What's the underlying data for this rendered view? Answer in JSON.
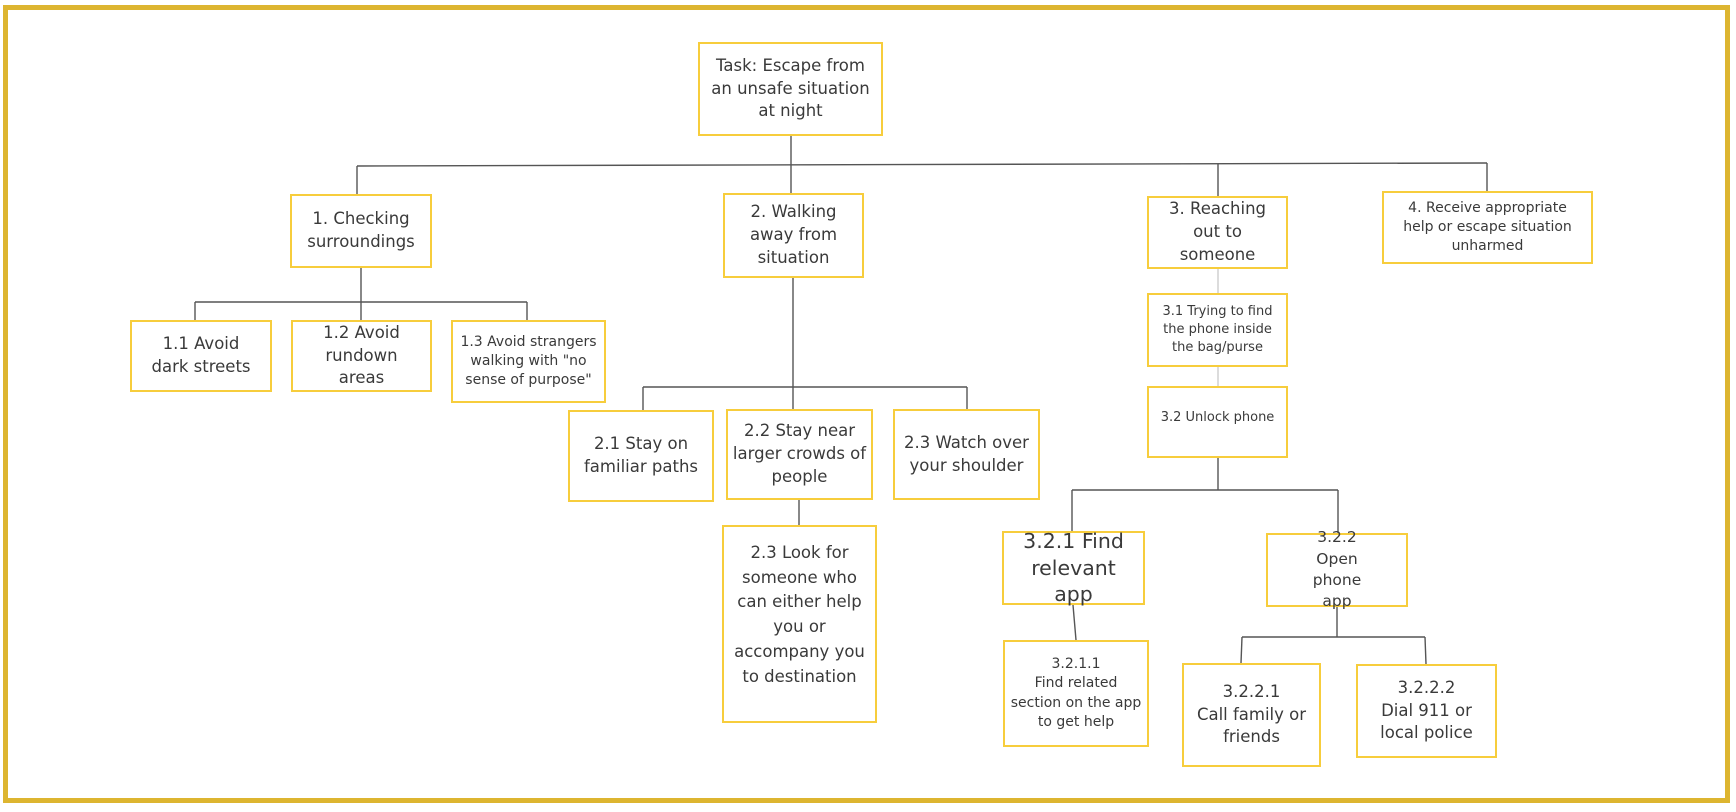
{
  "diagram": {
    "type": "hierarchical-task-analysis",
    "colors": {
      "frame_border": "#DDB530",
      "node_border": "#F7CD3C",
      "connector": "#555555",
      "connector_light": "#cccccc",
      "text": "#3a3a3a"
    },
    "nodes": {
      "root": "Task: Escape from an unsafe situation at night",
      "n1": "1. Checking surroundings",
      "n1_1": "1.1 Avoid dark streets",
      "n1_2": "1.2 Avoid rundown areas",
      "n1_3": "1.3 Avoid strangers walking with \"no sense of purpose\"",
      "n2": "2. Walking away from situation",
      "n2_1": "2.1 Stay on familiar paths",
      "n2_2": "2.2 Stay near larger crowds of people",
      "n2_3a": "2.3 Watch over your shoulder",
      "n2_3b": "2.3 Look for someone who can either help you or accompany you to destination",
      "n3": "3. Reaching out to someone",
      "n3_1": "3.1 Trying to find the phone inside the bag/purse",
      "n3_2": "3.2 Unlock phone",
      "n3_2_1": "3.2.1 Find relevant app",
      "n3_2_1_1_num": "3.2.1.1",
      "n3_2_1_1": "Find related section on the app to get help",
      "n3_2_2": "3.2.2 Open phone app",
      "n3_2_2_1_num": "3.2.2.1",
      "n3_2_2_1": "Call family or friends",
      "n3_2_2_2_num": "3.2.2.2",
      "n3_2_2_2": "Dial 911 or local police",
      "n4": "4. Receive appropriate help or escape situation unharmed"
    },
    "edges": [
      [
        "root",
        "n1"
      ],
      [
        "root",
        "n2"
      ],
      [
        "root",
        "n3"
      ],
      [
        "root",
        "n4"
      ],
      [
        "n1",
        "n1_1"
      ],
      [
        "n1",
        "n1_2"
      ],
      [
        "n1",
        "n1_3"
      ],
      [
        "n2",
        "n2_1"
      ],
      [
        "n2",
        "n2_2"
      ],
      [
        "n2",
        "n2_3a"
      ],
      [
        "n2_2",
        "n2_3b"
      ],
      [
        "n3",
        "n3_1"
      ],
      [
        "n3_1",
        "n3_2"
      ],
      [
        "n3_2",
        "n3_2_1"
      ],
      [
        "n3_2",
        "n3_2_2"
      ],
      [
        "n3_2_1",
        "n3_2_1_1"
      ],
      [
        "n3_2_2",
        "n3_2_2_1"
      ],
      [
        "n3_2_2",
        "n3_2_2_2"
      ]
    ]
  }
}
